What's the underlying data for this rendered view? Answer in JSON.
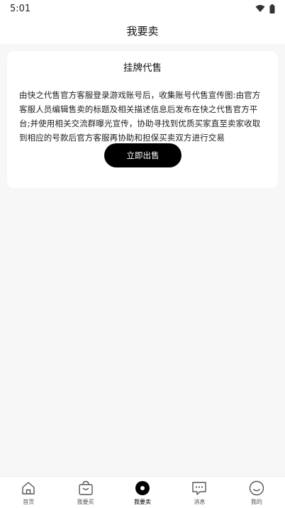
{
  "status_bar": {
    "time": "5:01",
    "icons": [
      "wifi-icon",
      "battery-icon"
    ]
  },
  "header": {
    "title": "我要卖"
  },
  "listing_card": {
    "title": "挂牌代售",
    "description": "由快之代售官方客服登录游戏账号后，收集账号代售宣传图:由官方客服人员编辑售卖的标题及相关描述信息后发布在快之代售官方平台;并使用相关交流群曝光宣传，协助寻找到优质买家直至卖家收取到相应的号款后官方客服再协助和担保买卖双方进行交易",
    "button_label": "立即出售"
  },
  "tab_bar": {
    "items": [
      {
        "label": "首页",
        "icon": "home-icon"
      },
      {
        "label": "我要买",
        "icon": "shopping-bag-icon"
      },
      {
        "label": "我要卖",
        "icon": "sell-icon",
        "active": true
      },
      {
        "label": "消息",
        "icon": "message-icon"
      },
      {
        "label": "我的",
        "icon": "profile-icon"
      }
    ]
  }
}
